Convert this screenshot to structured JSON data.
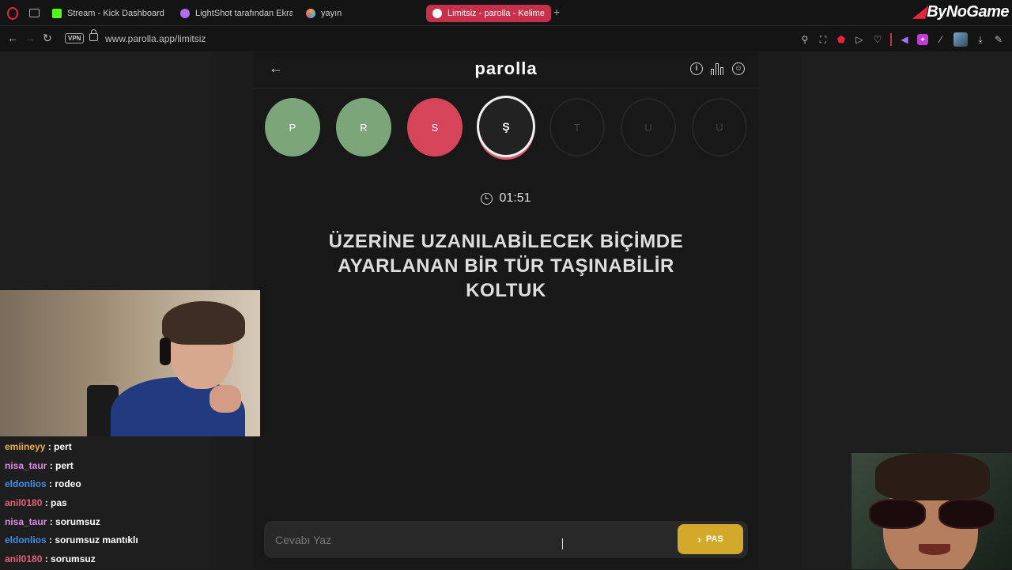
{
  "browser": {
    "tabs": [
      {
        "label": "Stream - Kick Dashboard",
        "favicon_color": "#53fc18"
      },
      {
        "label": "LightShot tarafından Ekra",
        "favicon_color": "#b36bff"
      },
      {
        "label": "yayın",
        "favicon_color": "#e8a33a"
      },
      {
        "label": "Limitsiz - parolla - Kelime",
        "favicon_color": "#ffffff",
        "active": true
      }
    ],
    "new_tab": "+",
    "vpn_label": "VPN",
    "url": "www.parolla.app/limitsiz",
    "brand": "ByNoGame"
  },
  "game": {
    "logo": "parolla",
    "letters": [
      {
        "char": "P",
        "state": "correct"
      },
      {
        "char": "R",
        "state": "correct"
      },
      {
        "char": "S",
        "state": "wrong"
      },
      {
        "char": "Ş",
        "state": "current"
      },
      {
        "char": "T",
        "state": "pending"
      },
      {
        "char": "U",
        "state": "pending"
      },
      {
        "char": "Ü",
        "state": "pending"
      }
    ],
    "timer": "01:51",
    "question": "ÜZERİNE UZANILABİLECEK BİÇİMDE AYARLANAN BİR TÜR TAŞINABİLİR KOLTUK",
    "answer_placeholder": "Cevabı Yaz",
    "pass_label": "PAS",
    "colors": {
      "correct": "#7aa67a",
      "wrong": "#d54458",
      "pass": "#d3a92b"
    }
  },
  "chat": [
    {
      "user": "emiineyy",
      "message": "pert",
      "color": "#e9b04a"
    },
    {
      "user": "nisa_taur",
      "message": "pert",
      "color": "#d98be6"
    },
    {
      "user": "eldonlios",
      "message": "rodeo",
      "color": "#3f8fe8"
    },
    {
      "user": "anil0180",
      "message": "pas",
      "color": "#e5607a"
    },
    {
      "user": "nisa_taur",
      "message": "sorumsuz",
      "color": "#d98be6"
    },
    {
      "user": "eldonlios",
      "message": "sorumsuz mantıklı",
      "color": "#3f8fe8"
    },
    {
      "user": "anil0180",
      "message": "sorumsuz",
      "color": "#e5607a"
    }
  ]
}
